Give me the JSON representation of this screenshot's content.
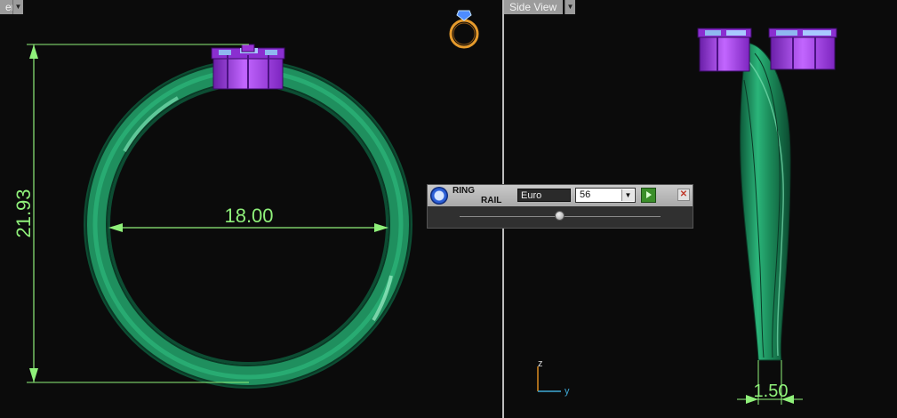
{
  "viewports": {
    "front": {
      "label": "er"
    },
    "side": {
      "label": "Side View"
    }
  },
  "dimensions": {
    "height": "21.93",
    "inner_diameter": "18.00",
    "shank_width": "1.50"
  },
  "axis": {
    "z": "z",
    "y": "y"
  },
  "ring_rail": {
    "title_line1": "RING",
    "title_line2": "RAIL",
    "standard": "Euro",
    "size": "56",
    "slider_fraction": 0.5
  },
  "colors": {
    "ring_green": "#1f8f5e",
    "gem_purple": "#9a33d6",
    "gem_blue": "#8fb8f0",
    "dimension_green": "#8ff07a",
    "background": "#0b0b0b"
  },
  "icons": [
    "ring-icon",
    "ring-rail-logo-icon",
    "dropdown-arrow-icon",
    "play-icon",
    "close-icon",
    "axis-gizmo-icon"
  ]
}
